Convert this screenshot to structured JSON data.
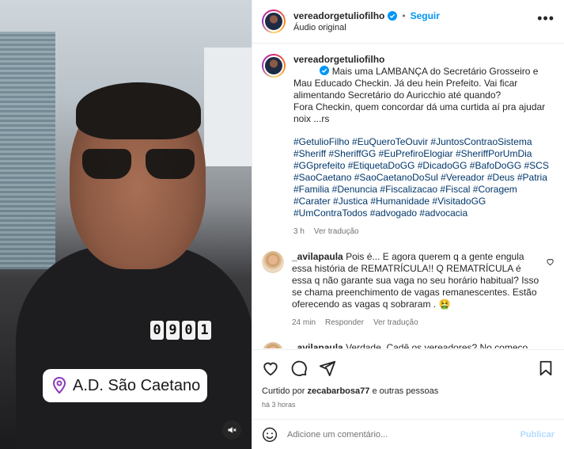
{
  "video": {
    "counter_digits": [
      "0",
      "9",
      "0",
      "1"
    ],
    "location": "A.D. São Caetano"
  },
  "header": {
    "username": "vereadorgetuliofilho",
    "follow_label": "Seguir",
    "audio": "Áudio original",
    "dot": "•"
  },
  "caption": {
    "username": "vereadorgetuliofilho",
    "text": "Mais uma LAMBANÇA do Secretário Grosseiro e Mau Educado Checkin. Já deu hein Prefeito. Vai ficar alimentando Secretário do Auricchio até quando?\nFora Checkin, quem concordar dá uma curtida aí pra ajudar noix ...rs",
    "hashtags": "#GetulioFilho #EuQueroTeOuvir #JuntosContraoSistema #Sheriff #SheriffGG #EuPrefiroElogiar #SheriffPorUmDia #GGprefeito #EtiquetaDoGG #DicadoGG #BafoDoGG #SCS #SaoCaetano #SaoCaetanoDoSul #Vereador #Deus #Patria #Familia #Denuncia #Fiscalizacao #Fiscal #Coragem #Carater #Justica #Humanidade #VisitadoGG #UmContraTodos #advogado #advocacia",
    "time": "3 h",
    "translate": "Ver tradução"
  },
  "comments": [
    {
      "username": "_avilapaula",
      "text": "Pois é... E agora querem q a gente engula essa história de REMATRÍCULA!! Q REMATRÍCULA é essa q não garante sua vaga no seu horário habitual? Isso se chama preenchimento de vagas remanescentes. Estão oferecendo as vagas q sobraram . 🤮",
      "time": "24 min",
      "reply": "Responder",
      "translate": "Ver tradução"
    },
    {
      "username": "_avilapaula",
      "text": "Verdade. Cadê os vereadores? No começo quando o site não funcionou ninguém apareceu querendo ser o pai da criança, aí apareceram só dps q conseguimos a PROMESSA da REMATRÍCULA e agora sumiram tudo de novo! 🤮 E q"
    }
  ],
  "actions": {
    "liked_prefix": "Curtido por",
    "liked_user": "zecabarbosa77",
    "liked_suffix": "e outras pessoas",
    "time": "há 3 horas"
  },
  "add_comment": {
    "placeholder": "Adicione um comentário...",
    "publish": "Publicar"
  },
  "colors": {
    "link": "#0095f6",
    "hashtag": "#00376b",
    "muted": "#737373"
  }
}
